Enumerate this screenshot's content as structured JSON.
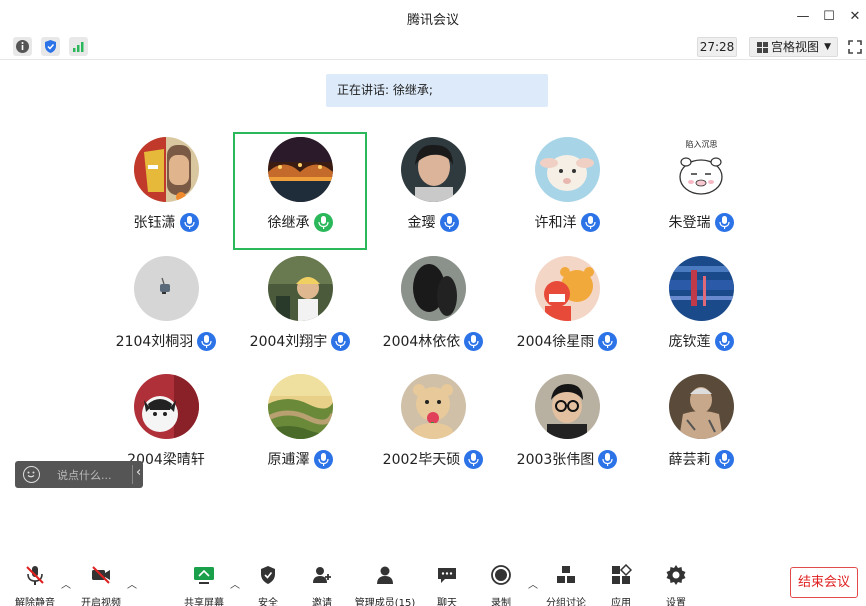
{
  "window": {
    "title": "腾讯会议",
    "controls": {
      "minimize": "—",
      "maximize": "☐",
      "close": "✕"
    }
  },
  "infobar": {
    "icons": [
      "info-icon",
      "shield-icon",
      "signal-icon"
    ],
    "timer": "27:28",
    "view_mode": "宫格视图",
    "fullscreen_icon": "fullscreen-icon"
  },
  "speaking": {
    "label": "正在讲话: 徐继承;"
  },
  "participants": [
    {
      "name": "张钰潇",
      "mic": "blue",
      "avatar": "iron-man-avatar",
      "host": true
    },
    {
      "name": "徐继承",
      "mic": "green",
      "avatar": "bridge-night-avatar",
      "active": true
    },
    {
      "name": "金璎",
      "mic": "blue",
      "avatar": "person-portrait-avatar"
    },
    {
      "name": "许和洋",
      "mic": "blue",
      "avatar": "lamb-avatar"
    },
    {
      "name": "朱登瑞",
      "mic": "blue",
      "avatar": "cartoon-pig-avatar",
      "avatar_caption": "陷入沉思"
    },
    {
      "name": "2104刘桐羽",
      "mic": "blue",
      "avatar": "small-object-avatar"
    },
    {
      "name": "2004刘翔宇",
      "mic": "blue",
      "avatar": "child-photo-avatar"
    },
    {
      "name": "2004林依依",
      "mic": "blue",
      "avatar": "silhouette-avatar"
    },
    {
      "name": "2004徐星雨",
      "mic": "blue",
      "avatar": "winnie-pooh-avatar"
    },
    {
      "name": "庞钦莲",
      "mic": "blue",
      "avatar": "blue-glitch-avatar"
    },
    {
      "name": "2004梁晴轩",
      "mic": "blue",
      "avatar": "cat-avatar"
    },
    {
      "name": "原逋澤",
      "mic": "blue",
      "avatar": "great-wall-avatar"
    },
    {
      "name": "2002毕天硕",
      "mic": "blue",
      "avatar": "teddy-bear-avatar"
    },
    {
      "name": "2003张伟图",
      "mic": "blue",
      "avatar": "glasses-man-avatar"
    },
    {
      "name": "薛芸莉",
      "mic": "blue",
      "avatar": "tattoo-man-avatar"
    }
  ],
  "chat": {
    "placeholder": "说点什么...",
    "collapse_icon": "‹"
  },
  "toolbar": {
    "unmute": "解除静音",
    "start_video": "开启视频",
    "share_screen": "共享屏幕",
    "security": "安全",
    "invite": "邀请",
    "manage_members": "管理成员(15)",
    "chat": "聊天",
    "record": "录制",
    "breakout": "分组讨论",
    "apps": "应用",
    "settings": "设置",
    "end_meeting": "结束会议"
  },
  "colors": {
    "accent_blue": "#2d73e8",
    "speaking_green": "#2bb85b",
    "banner_bg": "#dceafa",
    "end_red": "#e02020"
  }
}
